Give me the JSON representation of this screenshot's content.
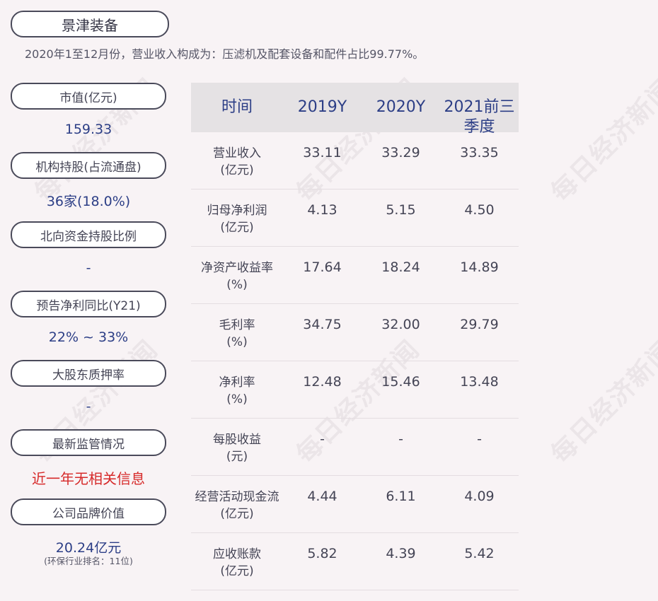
{
  "company": "景津装备",
  "summary": "2020年1至12月份，营业收入构成为：压滤机及配套设备和配件占比99.77%。",
  "metrics": [
    {
      "label": "市值(亿元)",
      "value": "159.33"
    },
    {
      "label": "机构持股(占流通盘)",
      "value": "36家(18.0%)"
    },
    {
      "label": "北向资金持股比例",
      "value": "-"
    },
    {
      "label": "预告净利同比(Y21)",
      "value": "22% ~ 33%"
    },
    {
      "label": "大股东质押率",
      "value": "-"
    },
    {
      "label": "最新监管情况",
      "value": "近一年无相关信息"
    },
    {
      "label": "公司品牌价值",
      "value": "20.24亿元",
      "note": "(环保行业排名：11位)"
    }
  ],
  "table": {
    "headers": [
      "时间",
      "2019Y",
      "2020Y",
      "2021前三季度"
    ],
    "rows": [
      {
        "label_line1": "营业收入",
        "label_line2": "(亿元)",
        "values": [
          "33.11",
          "33.29",
          "33.35"
        ]
      },
      {
        "label_line1": "归母净利润",
        "label_line2": "(亿元)",
        "values": [
          "4.13",
          "5.15",
          "4.50"
        ]
      },
      {
        "label_line1": "净资产收益率",
        "label_line2": "(%)",
        "values": [
          "17.64",
          "18.24",
          "14.89"
        ]
      },
      {
        "label_line1": "毛利率",
        "label_line2": "(%)",
        "values": [
          "34.75",
          "32.00",
          "29.79"
        ]
      },
      {
        "label_line1": "净利率",
        "label_line2": "(%)",
        "values": [
          "12.48",
          "15.46",
          "13.48"
        ]
      },
      {
        "label_line1": "每股收益",
        "label_line2": "(元)",
        "values": [
          "-",
          "-",
          "-"
        ]
      },
      {
        "label_line1": "经营活动现金流",
        "label_line2": "(亿元)",
        "values": [
          "4.44",
          "6.11",
          "4.09"
        ]
      },
      {
        "label_line1": "应收账款",
        "label_line2": "(亿元)",
        "values": [
          "5.82",
          "4.39",
          "5.42"
        ]
      }
    ]
  },
  "watermark": "每日经济新闻",
  "colors": {
    "accent": "#2c3e86",
    "alert": "#d62a2a",
    "background": "#f8f3f5"
  }
}
